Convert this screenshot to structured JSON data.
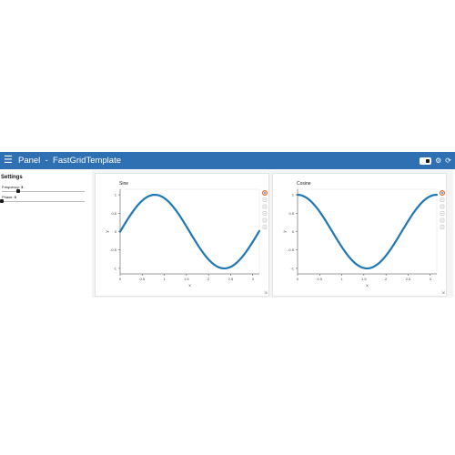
{
  "header": {
    "menu_icon": "hamburger-menu-icon",
    "title": "Panel  -  FastGridTemplate",
    "theme_toggle_icon": "theme-toggle-icon",
    "settings_icon": "gear-icon",
    "refresh_icon": "reload-icon",
    "background": "#2f70b2"
  },
  "sidebar": {
    "title": "Settings",
    "frequency": {
      "label": "Frequency:",
      "value": "3"
    },
    "phase": {
      "label": "Phase:",
      "value": "0"
    }
  },
  "chart_data": [
    {
      "type": "line",
      "title": "Sine",
      "xlabel": "x",
      "ylabel": "y",
      "xlim": [
        0,
        3.15
      ],
      "ylim": [
        -1.15,
        1.15
      ],
      "xticks": [
        "0",
        "0.5",
        "1",
        "1.5",
        "2",
        "2.5",
        "3"
      ],
      "xtick_values": [
        0,
        0.5,
        1,
        1.5,
        2,
        2.5,
        3
      ],
      "yticks": [
        "-1",
        "-0.5",
        "0",
        "0.5",
        "1"
      ],
      "ytick_values": [
        -1,
        -0.5,
        0,
        0.5,
        1
      ],
      "function": "sin",
      "frequency": 2,
      "color": "#1f77b4"
    },
    {
      "type": "line",
      "title": "Cosine",
      "xlabel": "x",
      "ylabel": "y",
      "xlim": [
        0,
        3.15
      ],
      "ylim": [
        -1.15,
        1.15
      ],
      "xticks": [
        "0",
        "0.5",
        "1",
        "1.5",
        "2",
        "2.5",
        "3"
      ],
      "xtick_values": [
        0,
        0.5,
        1,
        1.5,
        2,
        2.5,
        3
      ],
      "yticks": [
        "-1",
        "-0.5",
        "0",
        "0.5",
        "1"
      ],
      "ytick_values": [
        -1,
        -0.5,
        0,
        0.5,
        1
      ],
      "function": "cos",
      "frequency": 2,
      "color": "#1f77b4"
    }
  ],
  "toolbar": {
    "icons": [
      "bokeh-logo-icon",
      "pan-icon",
      "box-zoom-icon",
      "wheel-zoom-icon",
      "save-icon",
      "reset-icon"
    ]
  }
}
